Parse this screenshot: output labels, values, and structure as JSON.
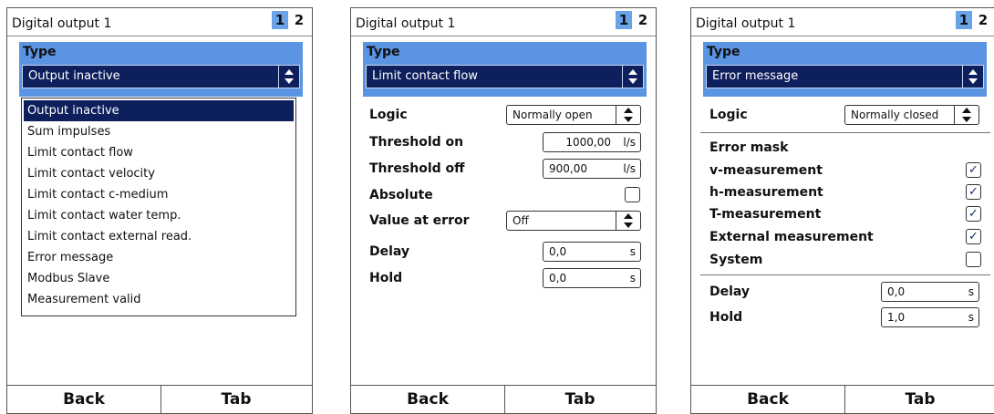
{
  "panels": [
    {
      "title": "Digital output 1",
      "tab1": "1",
      "tab2": "2",
      "type_label": "Type",
      "type_value": "Output inactive",
      "dropdown_items": [
        "Output inactive",
        "Sum impulses",
        "Limit contact flow",
        "Limit contact velocity",
        "Limit contact c-medium",
        "Limit contact water temp.",
        "Limit contact external read.",
        "Error message",
        "Modbus Slave",
        "Measurement valid"
      ],
      "back_label": "Back",
      "tab_label": "Tab"
    },
    {
      "title": "Digital output 1",
      "tab1": "1",
      "tab2": "2",
      "type_label": "Type",
      "type_value": "Limit contact flow",
      "logic_label": "Logic",
      "logic_value": "Normally open",
      "threshold_on_label": "Threshold on",
      "threshold_on_value": "1000,00",
      "threshold_on_unit": "l/s",
      "threshold_off_label": "Threshold off",
      "threshold_off_value": "900,00",
      "threshold_off_unit": "l/s",
      "absolute_label": "Absolute",
      "absolute_checked": false,
      "value_at_error_label": "Value at error",
      "value_at_error_value": "Off",
      "delay_label": "Delay",
      "delay_value": "0,0",
      "delay_unit": "s",
      "hold_label": "Hold",
      "hold_value": "0,0",
      "hold_unit": "s",
      "back_label": "Back",
      "tab_label": "Tab"
    },
    {
      "title": "Digital output 1",
      "tab1": "1",
      "tab2": "2",
      "type_label": "Type",
      "type_value": "Error message",
      "logic_label": "Logic",
      "logic_value": "Normally closed",
      "error_mask_label": "Error mask",
      "v_label": "v-measurement",
      "v_check": "✓",
      "h_label": "h-measurement",
      "h_check": "✓",
      "t_label": "T-measurement",
      "t_check": "✓",
      "ext_label": "External measurement",
      "ext_check": "✓",
      "system_label": "System",
      "system_check": "",
      "delay_label": "Delay",
      "delay_value": "0,0",
      "delay_unit": "s",
      "hold_label": "Hold",
      "hold_value": "1,0",
      "hold_unit": "s",
      "back_label": "Back",
      "tab_label": "Tab"
    }
  ],
  "colors": {
    "header_blue": "#5a94e2",
    "selected_navy": "#0d1f5c",
    "tab_highlight": "#6aa3e8"
  }
}
